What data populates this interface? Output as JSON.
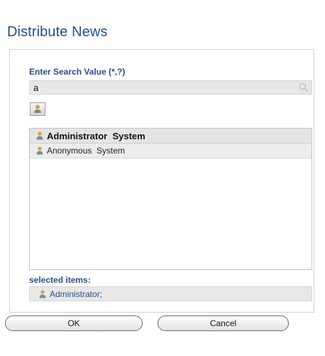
{
  "dialog": {
    "title": "Distribute News"
  },
  "search": {
    "label": "Enter Search Value (*,?)",
    "value": "a",
    "icon": "search-icon"
  },
  "user_button": {
    "icon": "user-icon"
  },
  "results": [
    {
      "name": "Administrator  System",
      "selected": true,
      "icon": "user-icon"
    },
    {
      "name": "Anonymous  System",
      "selected": false,
      "icon": "user-icon"
    }
  ],
  "selected": {
    "label": "selected items:",
    "value": "Administrator;",
    "icon": "user-icon"
  },
  "buttons": {
    "ok": "OK",
    "cancel": "Cancel"
  },
  "colors": {
    "title": "#214f8f",
    "label": "#2a4f87"
  }
}
